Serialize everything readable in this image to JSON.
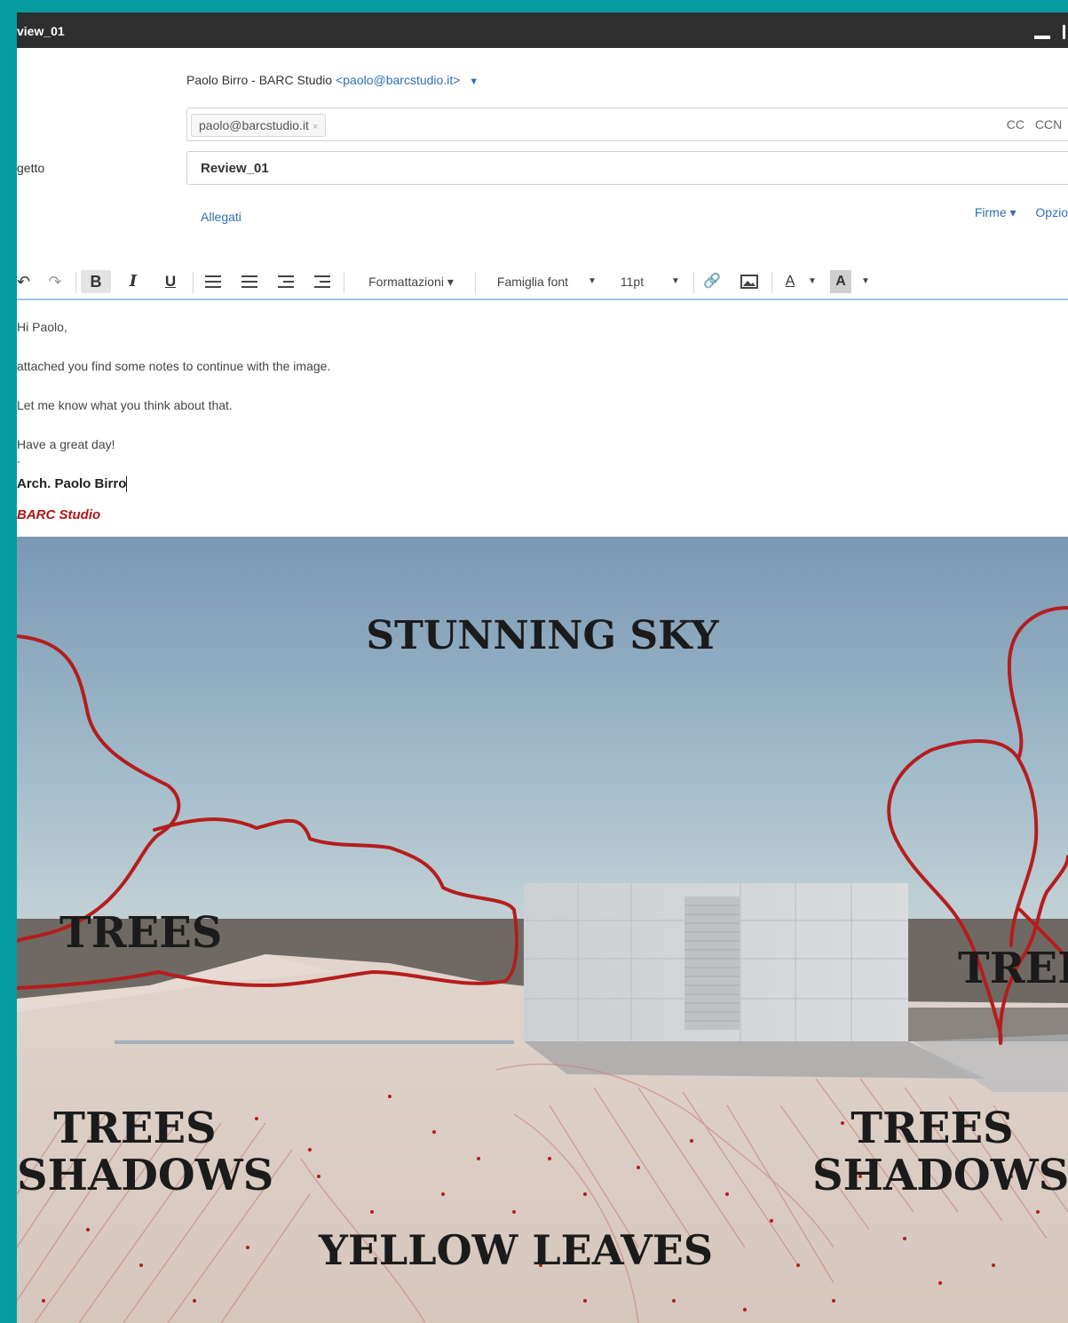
{
  "window": {
    "title": "view_01"
  },
  "compose": {
    "from_name": "Paolo Birro - BARC Studio",
    "from_email": "<paolo@barcstudio.it>",
    "to_chip": "paolo@barcstudio.it",
    "cc": "CC",
    "ccn": "CCN",
    "subject_label": "getto",
    "subject_value": "Review_01",
    "attachments": "Allegati",
    "signatures": "Firme ▾",
    "options": "Opzio"
  },
  "toolbar": {
    "bold": "B",
    "italic": "I",
    "underline": "U",
    "formatting": "Formattazioni ▾",
    "font_family": "Famiglia font",
    "font_size": "11pt",
    "text_color": "A",
    "bg_color": "A"
  },
  "body": {
    "greeting": "Hi Paolo,",
    "line1": "attached you find some notes to continue with the image.",
    "line2": "Let me know what you think about that.",
    "line3": "Have a great day!",
    "dash": "-",
    "signature_name": "Arch. Paolo Birro",
    "signature_studio": "BARC Studio"
  },
  "annotations": {
    "sky": "STUNNING SKY",
    "trees_left": "TREES",
    "trees_right": "TREE",
    "shadows_left_1": "TREES",
    "shadows_left_2": "SHADOWS",
    "shadows_right_1": "TREES",
    "shadows_right_2": "SHADOWS",
    "leaves": "YELLOW LEAVES"
  },
  "colors": {
    "frame_bg": "#069ba0",
    "link": "#2f6fb5",
    "annotation_red": "#b51d1d",
    "signature_red": "#b3141c"
  }
}
